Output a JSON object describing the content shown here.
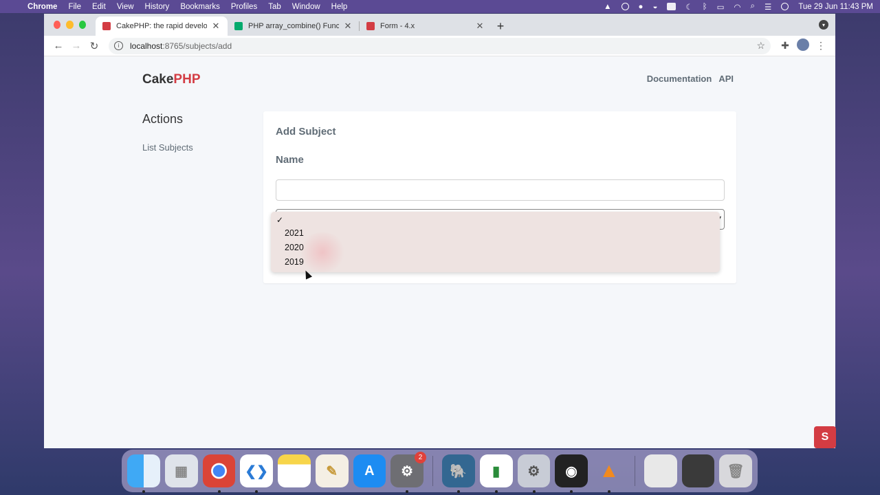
{
  "menubar": {
    "app_name": "Chrome",
    "menus": [
      "File",
      "Edit",
      "View",
      "History",
      "Bookmarks",
      "Profiles",
      "Tab",
      "Window",
      "Help"
    ],
    "clock": "Tue 29 Jun  11:43 PM"
  },
  "browser": {
    "tabs": [
      {
        "title": "CakePHP: the rapid developme",
        "favicon_color": "#d33c43"
      },
      {
        "title": "PHP array_combine() Function",
        "favicon_color": "#04aa6d"
      },
      {
        "title": "Form - 4.x",
        "favicon_color": "#d33c43"
      }
    ],
    "url_host": "localhost",
    "url_path": ":8765/subjects/add"
  },
  "page": {
    "brand_cake": "Cake",
    "brand_php": "PHP",
    "nav": {
      "documentation": "Documentation",
      "api": "API"
    },
    "sidebar": {
      "heading": "Actions",
      "link": "List Subjects"
    },
    "form": {
      "title": "Add Subject",
      "name_label": "Name",
      "name_value": "",
      "year_options": [
        "",
        "2021",
        "2020",
        "2019"
      ],
      "selected_index": 0
    }
  },
  "dock": {
    "settings_badge": "2",
    "apps": [
      "finder",
      "launchpad",
      "chrome",
      "vscode",
      "notes",
      "script-editor",
      "app-store",
      "system-preferences",
      "postgres",
      "activity-monitor",
      "system-preferences-2",
      "obs",
      "vlc",
      "files",
      "screenshot",
      "trash"
    ]
  }
}
